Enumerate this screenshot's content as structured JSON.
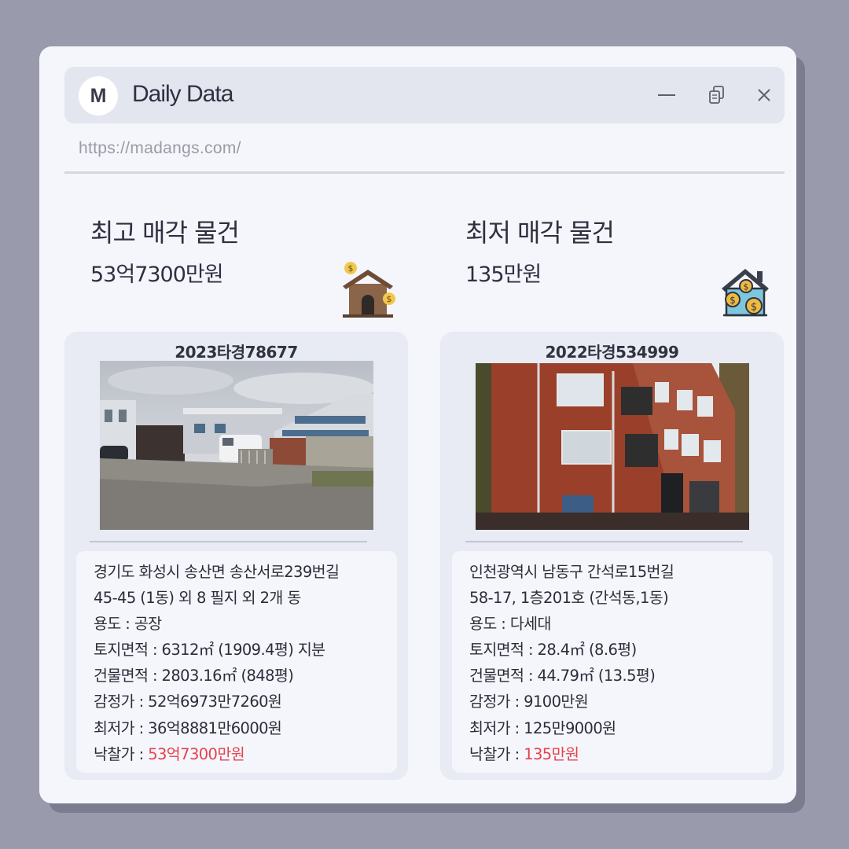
{
  "window": {
    "avatar_letter": "M",
    "title": "Daily Data",
    "url": "https://madangs.com/"
  },
  "icons": {
    "minimize": "minimize-icon",
    "restore": "restore-icon",
    "close": "close-icon",
    "left_summary": "house-money-icon",
    "right_summary": "house-coins-icon"
  },
  "colors": {
    "highlight": "#e5424d",
    "window_bg": "#f5f6fb",
    "card_bg": "#e8eaf4",
    "page_bg": "#9a9aad"
  },
  "left": {
    "heading": "최고 매각 물건",
    "price": "53억7300만원",
    "case_no": "2023타경78677",
    "address_1": "경기도 화성시 송산면 송산서로239번길",
    "address_2": "45-45 (1동) 외 8 필지 외 2개 동",
    "usage": "용도 : 공장",
    "land_area": "토지면적 : 6312㎡ (1909.4평) 지분",
    "building_area": "건물면적 : 2803.16㎡ (848평)",
    "appraisal": "감정가 : 52억6973만7260원",
    "minimum": "최저가 : 36억8881만6000원",
    "winning_label": "낙찰가 : ",
    "winning_value": "53억7300만원"
  },
  "right": {
    "heading": "최저 매각 물건",
    "price": "135만원",
    "case_no": "2022타경534999",
    "address_1": "인천광역시 남동구 간석로15번길",
    "address_2": "58-17, 1층201호 (간석동,1동)",
    "usage": "용도 : 다세대",
    "land_area": "토지면적 : 28.4㎡ (8.6평)",
    "building_area": "건물면적 : 44.79㎡ (13.5평)",
    "appraisal": "감정가 : 9100만원",
    "minimum": "최저가 : 125만9000원",
    "winning_label": "낙찰가 : ",
    "winning_value": "135만원"
  }
}
